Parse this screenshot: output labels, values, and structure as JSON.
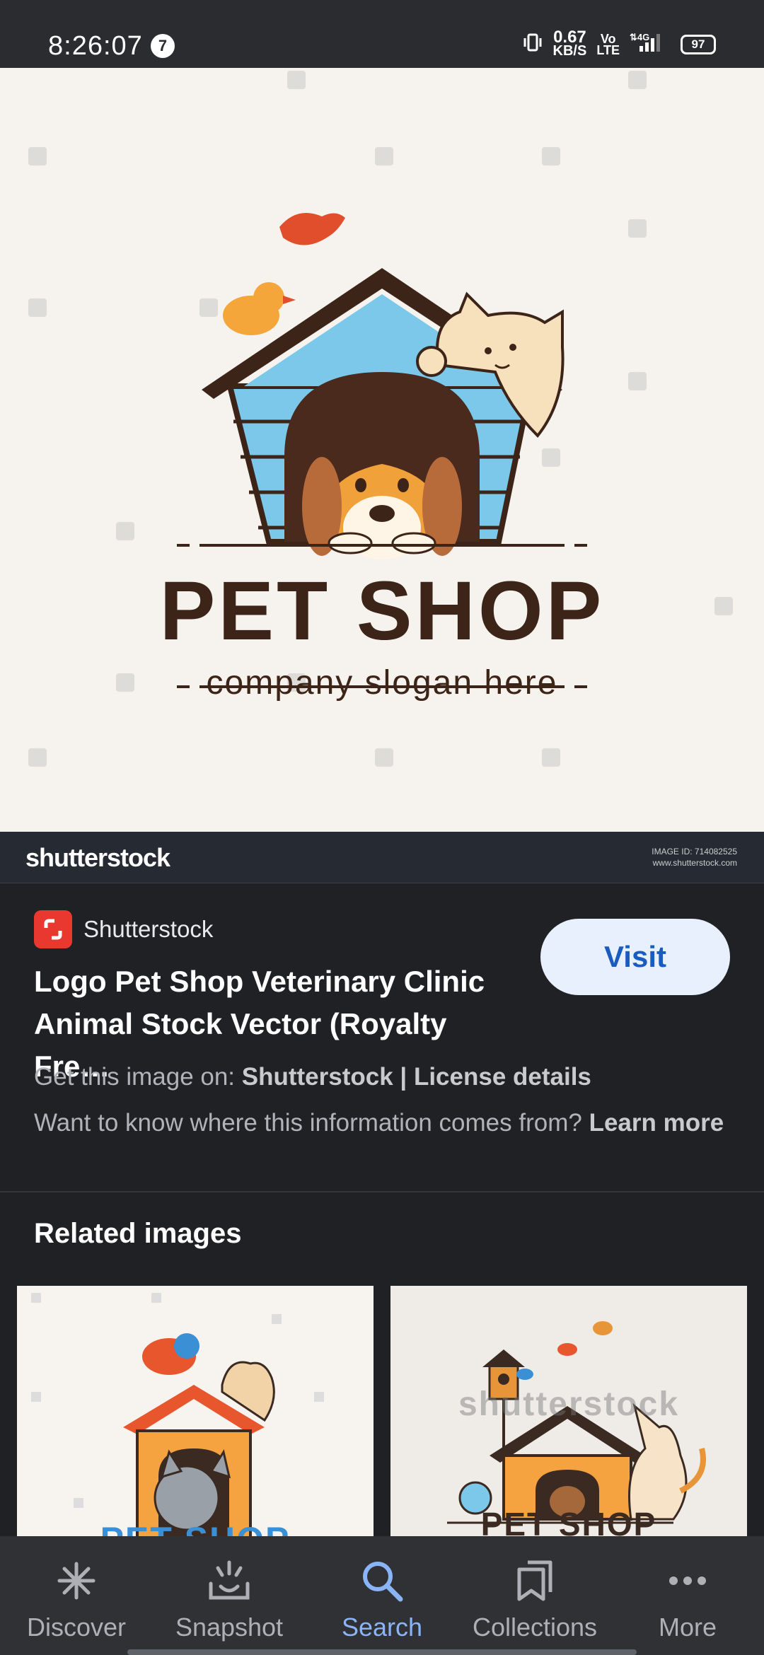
{
  "status_bar": {
    "time": "8:26:07",
    "notification_count": "7",
    "speed_value": "0.67",
    "speed_unit": "KB/S",
    "volte_top": "Vo",
    "volte_bottom": "LTE",
    "network": "4G",
    "battery": "97"
  },
  "hero_image": {
    "logo_title": "PET SHOP",
    "logo_slogan": "company slogan here",
    "watermark_brand": "shutterstock",
    "image_id_line": "IMAGE ID: 714082525",
    "image_site_line": "www.shutterstock.com"
  },
  "result": {
    "source_name": "Shutterstock",
    "visit_label": "Visit",
    "title": "Logo Pet Shop Veterinary Clinic Animal Stock Vector (Royalty Fre…",
    "get_prefix": "Get this image on: ",
    "get_source": "Shutterstock",
    "get_separator": " | ",
    "license_link": "License details",
    "info_text": "Want to know where this information comes from? ",
    "learn_more": "Learn more"
  },
  "related": {
    "title": "Related images",
    "items": [
      {
        "caption": "PET SHOP"
      },
      {
        "caption": "PET SHOP",
        "watermark": "shutterstock"
      }
    ]
  },
  "bottom_nav": {
    "items": [
      {
        "label": "Discover",
        "icon": "asterisk-icon"
      },
      {
        "label": "Snapshot",
        "icon": "snapshot-icon"
      },
      {
        "label": "Search",
        "icon": "search-icon"
      },
      {
        "label": "Collections",
        "icon": "collections-icon"
      },
      {
        "label": "More",
        "icon": "more-icon"
      }
    ],
    "active": "Search"
  },
  "colors": {
    "background": "#202124",
    "accent": "#8ab4f8",
    "visit_button": "#e8f0fe",
    "shutterstock_red": "#e8382f"
  }
}
